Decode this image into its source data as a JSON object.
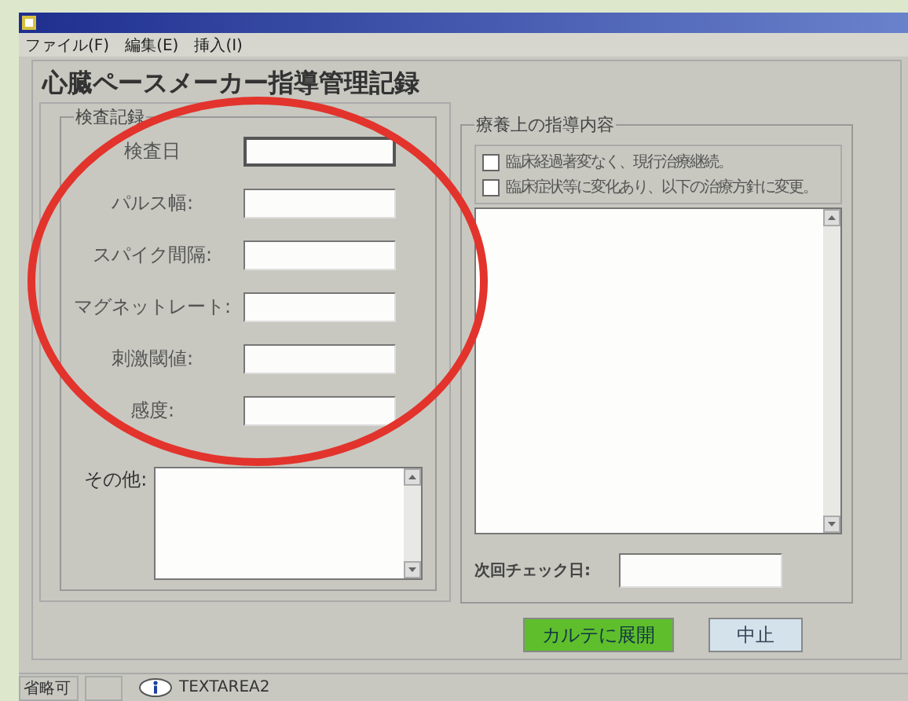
{
  "menu": [
    "ファイル(F)",
    "編集(E)",
    "挿入(I)"
  ],
  "form_title": "心臓ペースメーカー指導管理記録",
  "exam": {
    "legend": "検査記録",
    "fields": [
      {
        "label": "検査日"
      },
      {
        "label": "パルス幅:"
      },
      {
        "label": "スパイク間隔:"
      },
      {
        "label": "マグネットレート:"
      },
      {
        "label": "刺激閾値:"
      },
      {
        "label": "感度:"
      }
    ]
  },
  "other": {
    "label": "その他:"
  },
  "guidance": {
    "legend": "療養上の指導内容",
    "options": [
      {
        "label": "臨床経過著変なく、現行治療継続。",
        "checked": false
      },
      {
        "label": "臨床症状等に変化あり、以下の治療方針に変更。",
        "checked": false
      }
    ],
    "next_check": {
      "label": "次回チェック日:"
    }
  },
  "buttons": [
    {
      "label": "カルテに展開",
      "kind": "primary"
    },
    {
      "label": "中止",
      "kind": "secondary"
    }
  ],
  "status_bar": {
    "mode": "省略可",
    "field": "TEXTAREA2"
  }
}
